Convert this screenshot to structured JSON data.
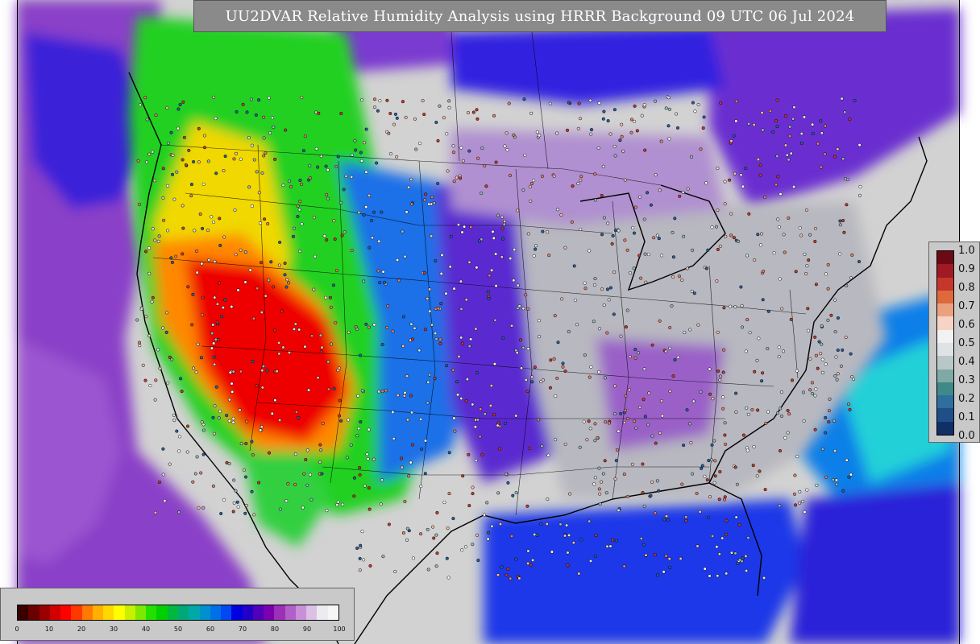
{
  "title": "UU2DVAR Relative Humidity Analysis using HRRR Background 09 UTC 06 Jul 2024",
  "colorbar_right": {
    "ticks": [
      "1.0",
      "0.9",
      "0.8",
      "0.7",
      "0.6",
      "0.5",
      "0.4",
      "0.3",
      "0.2",
      "0.1",
      "0.0"
    ],
    "colors": [
      "#6b0a14",
      "#a01a23",
      "#c6362c",
      "#de6a3c",
      "#eca17e",
      "#f6d3c4",
      "#f2f2f2",
      "#dfe3e5",
      "#b9c7c8",
      "#7fa9a4",
      "#3f8a88",
      "#2f6e9e",
      "#1f4f89",
      "#0f2f66"
    ]
  },
  "colorbar_bottom": {
    "ticks": [
      "0",
      "10",
      "20",
      "30",
      "40",
      "50",
      "60",
      "70",
      "80",
      "90",
      "100"
    ],
    "colors": [
      "#3a0000",
      "#6a0000",
      "#9a0000",
      "#d00000",
      "#ff0000",
      "#ff3800",
      "#ff7a00",
      "#ffb000",
      "#ffd800",
      "#ffff00",
      "#c8f000",
      "#7ee800",
      "#22e000",
      "#00d000",
      "#00b840",
      "#00a878",
      "#00a8a8",
      "#0090d0",
      "#0070e8",
      "#0048f0",
      "#0000e0",
      "#2200c8",
      "#5000b8",
      "#7a00b0",
      "#9c30b8",
      "#b060c8",
      "#c890d8",
      "#dcc0e6",
      "#ececf0",
      "#f6f6f6"
    ]
  }
}
